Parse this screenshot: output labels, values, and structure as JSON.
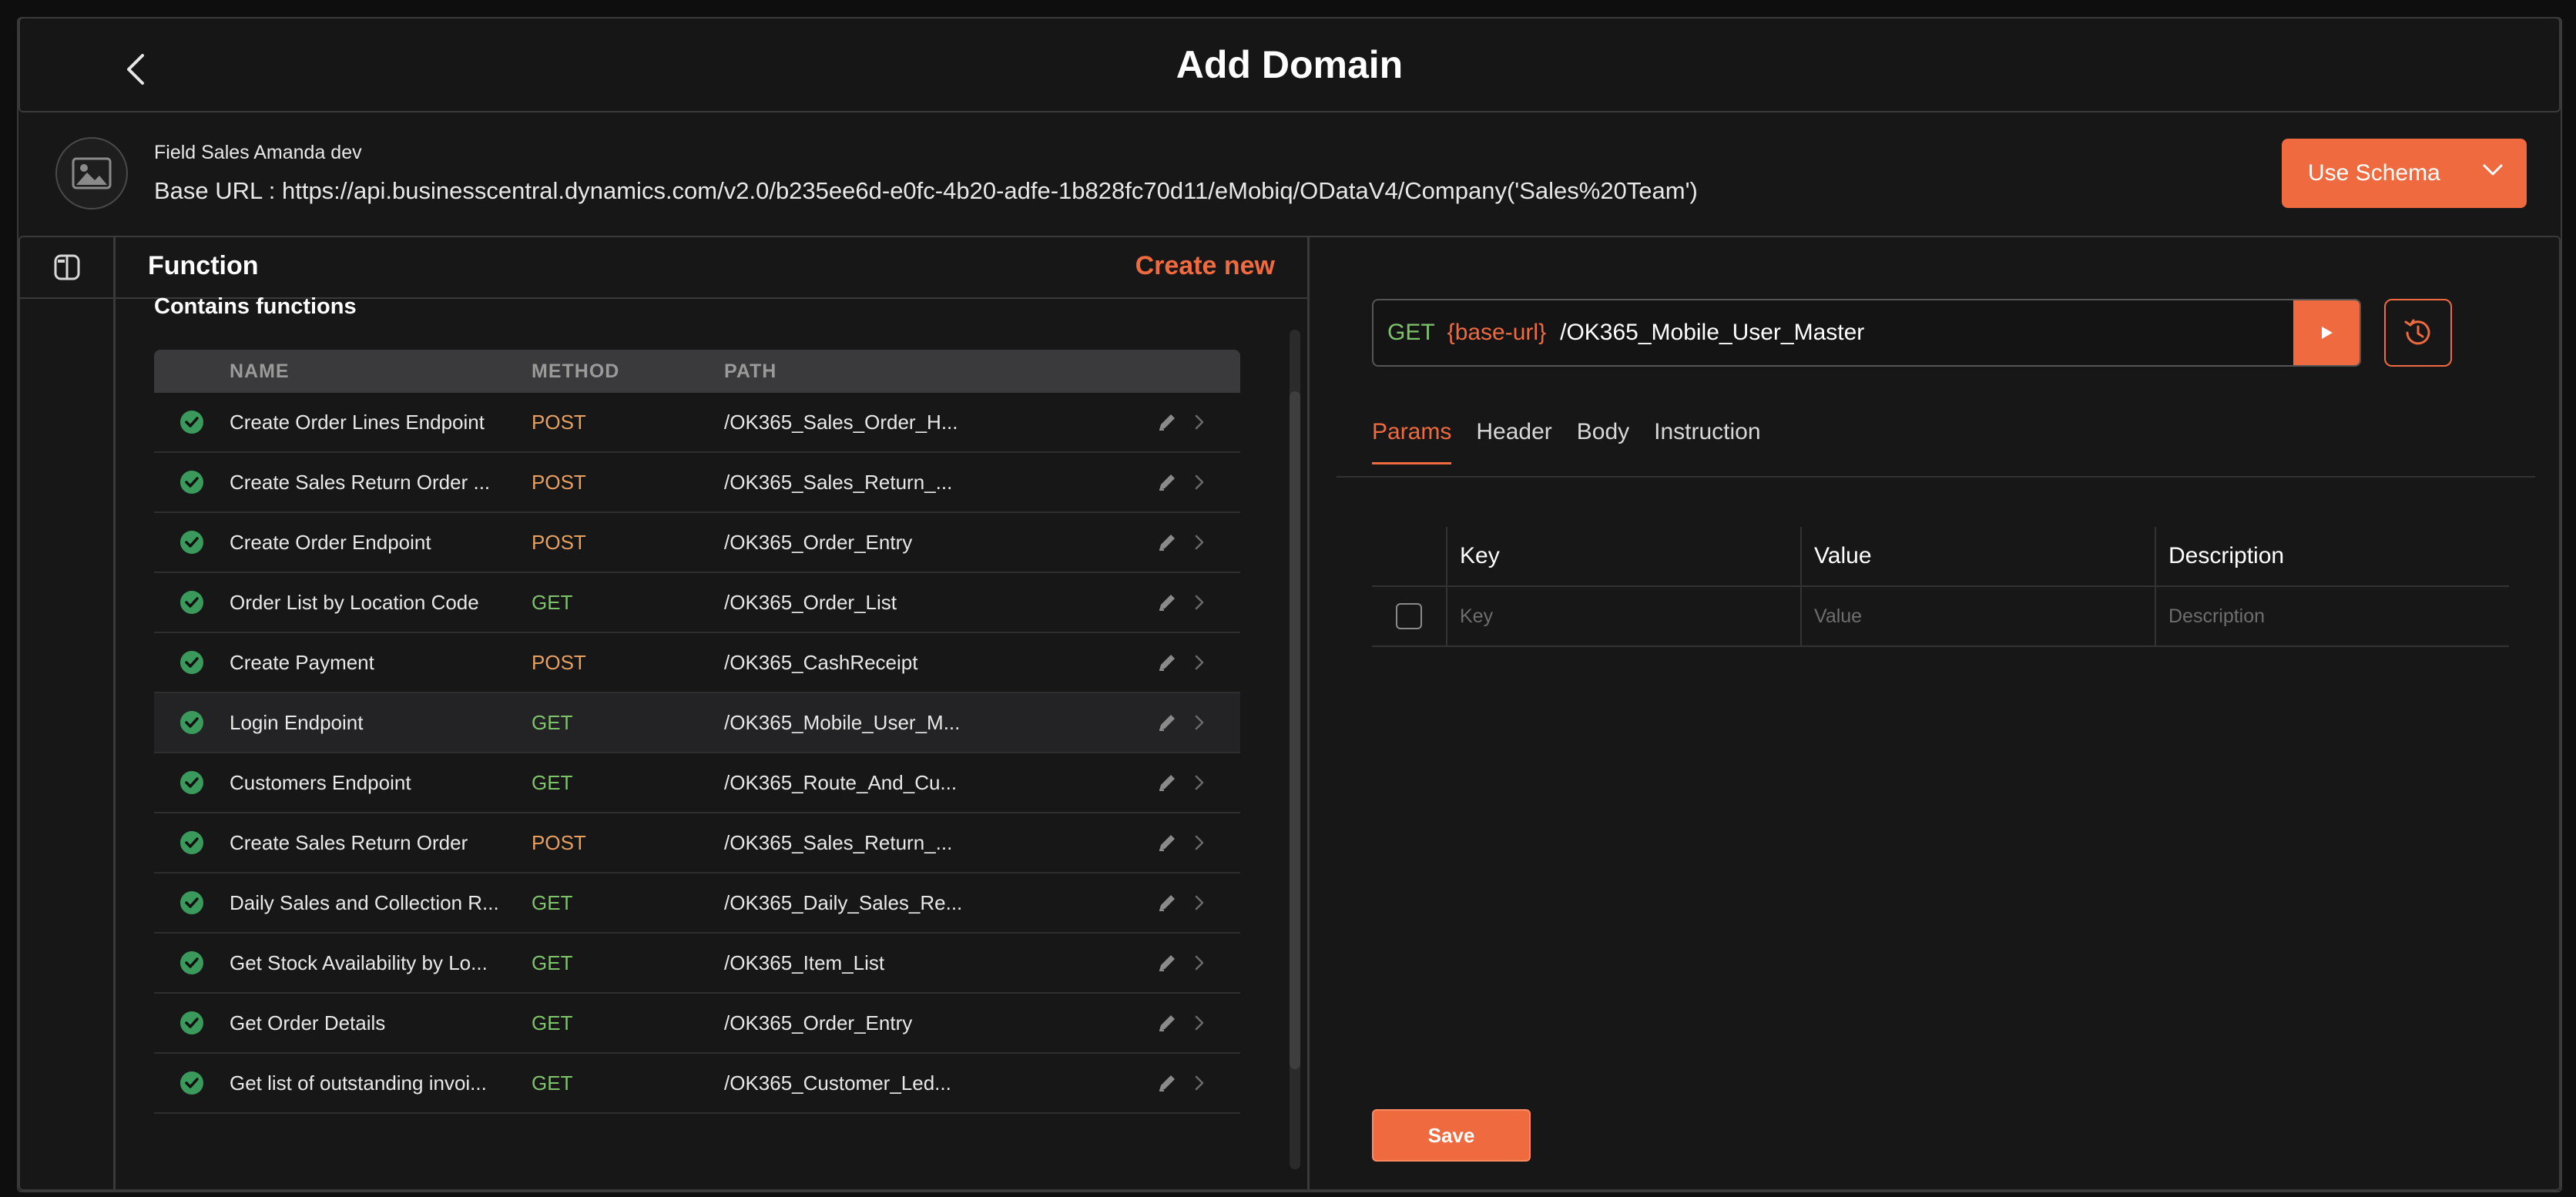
{
  "header": {
    "title": "Add Domain"
  },
  "domain": {
    "name": "Field Sales Amanda dev",
    "base_url": "Base URL : https://api.businesscentral.dynamics.com/v2.0/b235ee6d-e0fc-4b20-adfe-1b828fc70d11/eMobiq/ODataV4/Company('Sales%20Team')",
    "use_schema_label": "Use Schema"
  },
  "functions": {
    "title": "Function",
    "create_new": "Create new",
    "subtitle": "Contains functions",
    "columns": {
      "name": "NAME",
      "method": "METHOD",
      "path": "PATH"
    },
    "rows": [
      {
        "name": "Create Order Lines Endpoint",
        "method": "POST",
        "path": "/OK365_Sales_Order_H..."
      },
      {
        "name": "Create Sales Return Order ...",
        "method": "POST",
        "path": "/OK365_Sales_Return_..."
      },
      {
        "name": "Create Order Endpoint",
        "method": "POST",
        "path": "/OK365_Order_Entry"
      },
      {
        "name": "Order List by Location Code",
        "method": "GET",
        "path": "/OK365_Order_List"
      },
      {
        "name": "Create Payment",
        "method": "POST",
        "path": "/OK365_CashReceipt"
      },
      {
        "name": "Login Endpoint",
        "method": "GET",
        "path": "/OK365_Mobile_User_M..."
      },
      {
        "name": "Customers Endpoint",
        "method": "GET",
        "path": "/OK365_Route_And_Cu..."
      },
      {
        "name": "Create Sales Return Order",
        "method": "POST",
        "path": "/OK365_Sales_Return_..."
      },
      {
        "name": "Daily Sales and Collection R...",
        "method": "GET",
        "path": "/OK365_Daily_Sales_Re..."
      },
      {
        "name": "Get Stock Availability by Lo...",
        "method": "GET",
        "path": "/OK365_Item_List"
      },
      {
        "name": "Get Order Details",
        "method": "GET",
        "path": "/OK365_Order_Entry"
      },
      {
        "name": "Get list of outstanding invoi...",
        "method": "GET",
        "path": "/OK365_Customer_Led..."
      }
    ]
  },
  "request": {
    "method": "GET",
    "base": "{base-url}",
    "path": "/OK365_Mobile_User_Master",
    "tabs": [
      "Params",
      "Header",
      "Body",
      "Instruction"
    ],
    "params": {
      "columns": {
        "key": "Key",
        "value": "Value",
        "description": "Description"
      },
      "placeholders": {
        "key": "Key",
        "value": "Value",
        "description": "Description"
      }
    },
    "save_label": "Save"
  },
  "colors": {
    "accent": "#ef6a3f",
    "get": "#7ec26a",
    "post": "#e8a060",
    "success": "#3a9a5c"
  }
}
